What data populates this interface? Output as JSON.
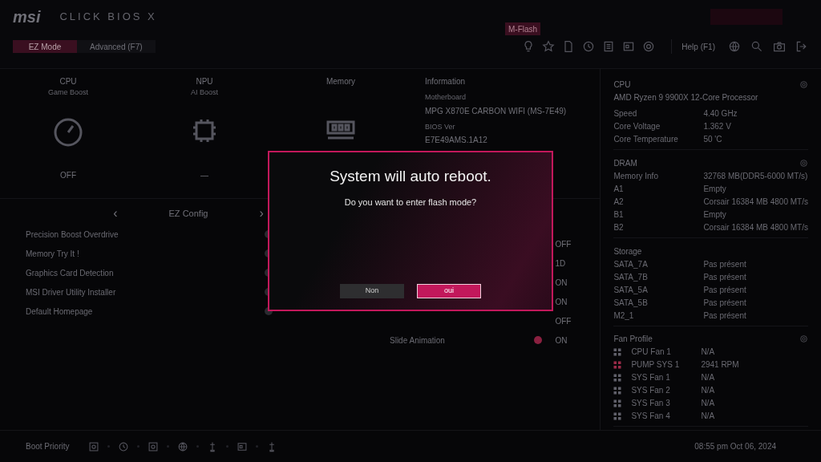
{
  "header": {
    "logo": "msi",
    "product": "CLICK BIOS X",
    "mflash": "M-Flash",
    "tabs": [
      {
        "label": "EZ Mode",
        "selected": true
      },
      {
        "label": "Advanced (F7)",
        "selected": false
      }
    ],
    "help": "Help (F1)"
  },
  "boost": [
    {
      "title": "CPU",
      "subtitle": "Game Boost",
      "value": "OFF",
      "kind": "gauge"
    },
    {
      "title": "NPU",
      "subtitle": "AI Boost",
      "value": "—",
      "kind": "chip"
    },
    {
      "title": "Memory",
      "kind": "ram"
    }
  ],
  "information": {
    "title": "Information",
    "fields": [
      {
        "label": "Motherboard",
        "value": "MPG X870E CARBON WIFI (MS-7E49)"
      },
      {
        "label": "BIOS Ver",
        "value": "E7E49AMS.1A12"
      }
    ]
  },
  "ez_config": {
    "prev": "‹",
    "title": "EZ Config",
    "next": "›",
    "left_items": [
      {
        "label": "Precision Boost Overdrive",
        "on": false
      },
      {
        "label": "Memory Try It !",
        "on": false
      },
      {
        "label": "Graphics Card Detection",
        "on": false
      },
      {
        "label": "MSI Driver Utility Installer",
        "on": false
      },
      {
        "label": "Default Homepage",
        "on": false
      }
    ],
    "right_items": [
      {
        "value": "OFF"
      },
      {
        "value": "1D"
      },
      {
        "value": "ON"
      },
      {
        "value": "ON"
      },
      {
        "value": "OFF"
      },
      {
        "label": "Slide Animation",
        "value": "ON",
        "on": true
      }
    ]
  },
  "sidebar": {
    "cpu": {
      "title": "CPU",
      "model": "AMD Ryzen 9 9900X 12-Core Processor",
      "rows": [
        {
          "label": "Speed",
          "value": "4.40 GHz"
        },
        {
          "label": "Core Voltage",
          "value": "1.362 V"
        },
        {
          "label": "Core Temperature",
          "value": "50 'C"
        }
      ]
    },
    "dram": {
      "title": "DRAM",
      "rows": [
        {
          "label": "Memory Info",
          "value": "32768 MB(DDR5-6000 MT/s)"
        },
        {
          "label": "A1",
          "value": "Empty"
        },
        {
          "label": "A2",
          "value": "Corsair 16384 MB 4800 MT/s"
        },
        {
          "label": "B1",
          "value": "Empty"
        },
        {
          "label": "B2",
          "value": "Corsair 16384 MB 4800 MT/s"
        }
      ]
    },
    "storage": {
      "title": "Storage",
      "rows": [
        {
          "label": "SATA_7A",
          "value": "Pas présent"
        },
        {
          "label": "SATA_7B",
          "value": "Pas présent"
        },
        {
          "label": "SATA_5A",
          "value": "Pas présent"
        },
        {
          "label": "SATA_5B",
          "value": "Pas présent"
        },
        {
          "label": "M2_1",
          "value": "Pas présent"
        }
      ]
    },
    "fans": {
      "title": "Fan Profile",
      "rows": [
        {
          "label": "CPU Fan 1",
          "value": "N/A",
          "color": "#60606a"
        },
        {
          "label": "PUMP SYS 1",
          "value": "2941 RPM",
          "color": "#9a2a48"
        },
        {
          "label": "SYS Fan 1",
          "value": "N/A",
          "color": "#60606a"
        },
        {
          "label": "SYS Fan 2",
          "value": "N/A",
          "color": "#60606a"
        },
        {
          "label": "SYS Fan 3",
          "value": "N/A",
          "color": "#60606a"
        },
        {
          "label": "SYS Fan 4",
          "value": "N/A",
          "color": "#60606a"
        }
      ]
    }
  },
  "footer": {
    "boot_label": "Boot Priority",
    "clock": "08:55 pm Oct 06, 2024"
  },
  "dialog": {
    "title": "System will auto reboot.",
    "message": "Do you want to enter flash mode?",
    "buttons": [
      {
        "label": "Non",
        "selected": false
      },
      {
        "label": "oui",
        "selected": true
      }
    ]
  }
}
